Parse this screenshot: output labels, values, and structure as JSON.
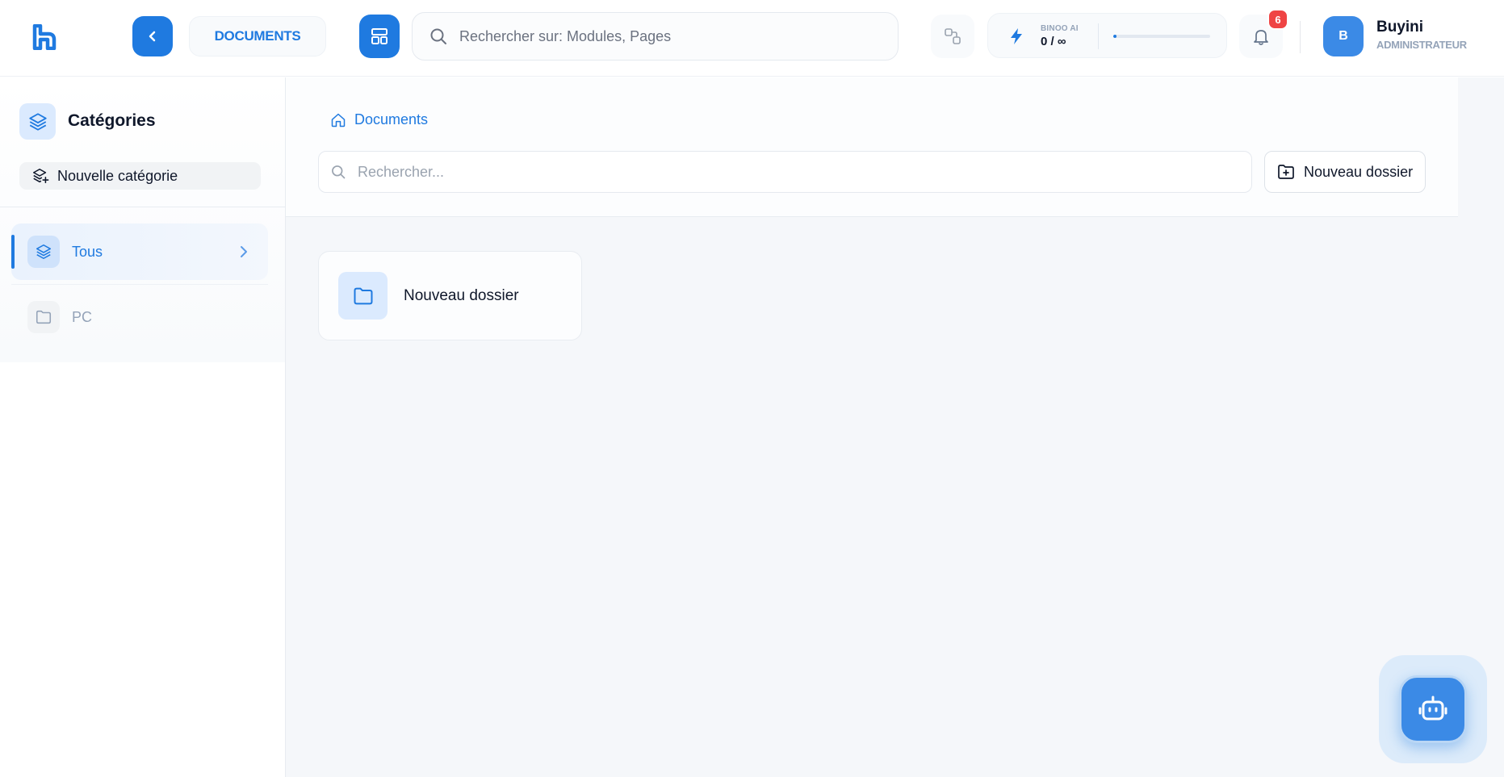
{
  "header": {
    "module_label": "DOCUMENTS",
    "search_placeholder": "Rechercher sur: Modules, Pages",
    "ai": {
      "label": "BINOO AI",
      "usage": "0 / ∞",
      "progress_fraction": 0.03
    },
    "notifications_count": "6",
    "user": {
      "initial": "B",
      "name": "Buyini",
      "role": "ADMINISTRATEUR"
    }
  },
  "sidebar": {
    "title": "Catégories",
    "new_category_label": "Nouvelle catégorie",
    "categories": [
      {
        "label": "Tous",
        "active": true
      },
      {
        "label": "PC",
        "active": false
      }
    ]
  },
  "main": {
    "breadcrumb": "Documents",
    "search_placeholder": "Rechercher...",
    "new_folder_label": "Nouveau dossier",
    "folders": [
      {
        "name": "Nouveau dossier"
      }
    ]
  },
  "colors": {
    "accent": "#1f7ae0",
    "badge": "#ef4444",
    "background": "#f5f7fa"
  }
}
